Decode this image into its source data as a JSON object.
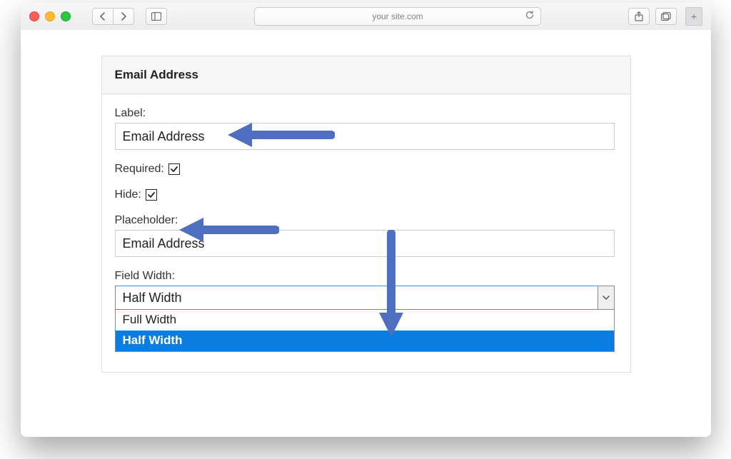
{
  "browser": {
    "url_display": "your site.com"
  },
  "panel": {
    "title": "Email Address",
    "label_label": "Label:",
    "label_value": "Email Address",
    "required_label": "Required:",
    "required_checked": true,
    "hide_label": "Hide:",
    "hide_checked": true,
    "placeholder_label": "Placeholder:",
    "placeholder_value": "Email Address",
    "field_width_label": "Field Width:",
    "field_width_value": "Half Width",
    "field_width_options": [
      "Full Width",
      "Half Width"
    ]
  },
  "colors": {
    "arrow": "#4e6fbf",
    "selected_blue": "#0a7de3"
  }
}
